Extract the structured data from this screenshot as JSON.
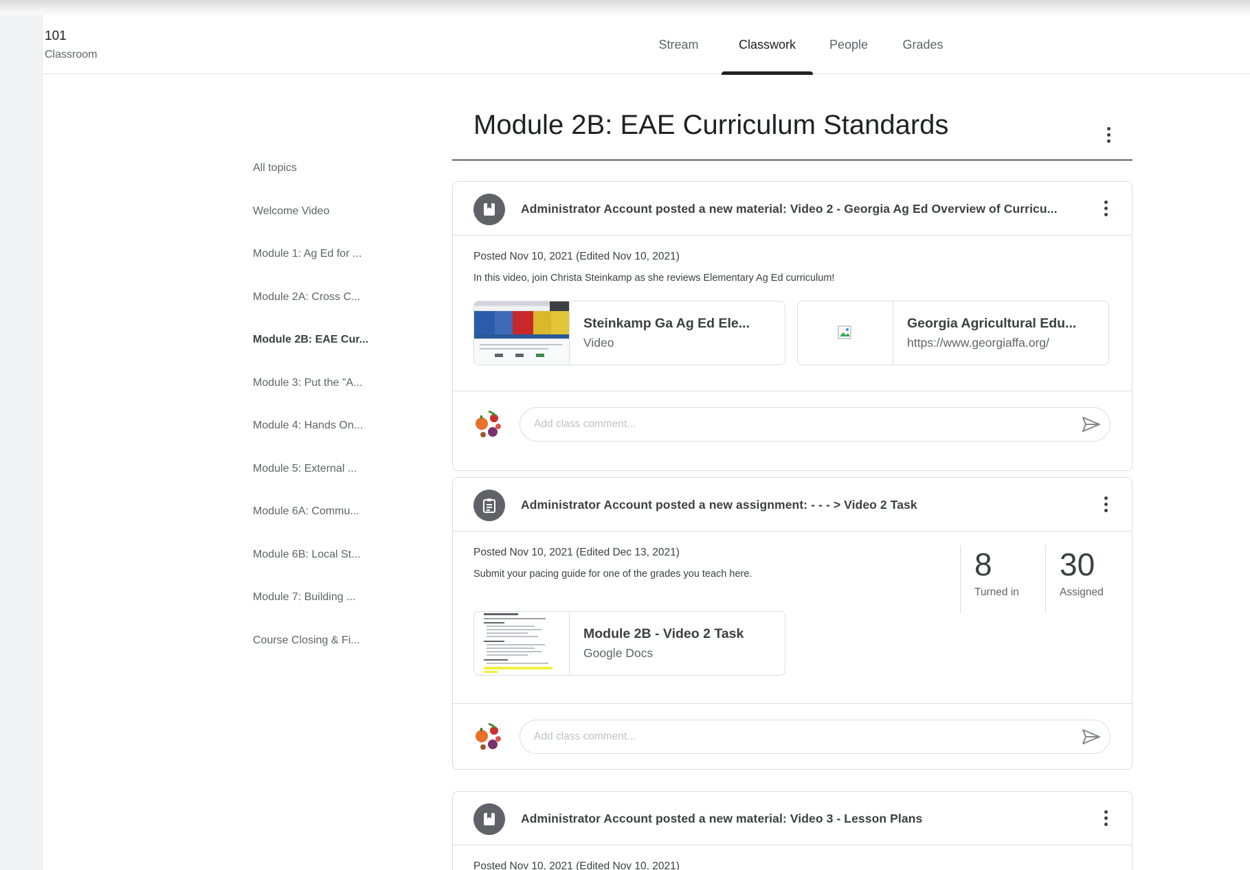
{
  "header": {
    "class_name": "101",
    "class_subtitle": "Classroom",
    "tabs": [
      {
        "label": "Stream",
        "active": false
      },
      {
        "label": "Classwork",
        "active": true
      },
      {
        "label": "People",
        "active": false
      },
      {
        "label": "Grades",
        "active": false
      }
    ]
  },
  "topics": [
    {
      "label": "All topics",
      "active": false
    },
    {
      "label": "Welcome Video",
      "active": false
    },
    {
      "label": "Module 1: Ag Ed for ...",
      "active": false
    },
    {
      "label": "Module 2A: Cross C...",
      "active": false
    },
    {
      "label": "Module 2B: EAE Cur...",
      "active": true
    },
    {
      "label": "Module 3: Put the \"A...",
      "active": false
    },
    {
      "label": "Module 4: Hands On...",
      "active": false
    },
    {
      "label": "Module 5: External ...",
      "active": false
    },
    {
      "label": "Module 6A: Commu...",
      "active": false
    },
    {
      "label": "Module 6B: Local St...",
      "active": false
    },
    {
      "label": "Module 7: Building ...",
      "active": false
    },
    {
      "label": "Course Closing & Fi...",
      "active": false
    }
  ],
  "section": {
    "title": "Module 2B: EAE Curriculum Standards"
  },
  "posts": [
    {
      "icon": "material-icon",
      "title": "Administrator Account posted a new material: Video 2 - Georgia Ag Ed Overview of Curricu...",
      "posted": "Posted Nov 10, 2021 (Edited Nov 10, 2021)",
      "description": "In this video, join Christa Steinkamp as she reviews Elementary Ag Ed curriculum!",
      "attachments": [
        {
          "title": "Steinkamp Ga Ag Ed Ele...",
          "subtitle": "Video",
          "thumb": "video-thumbnail"
        },
        {
          "title": "Georgia Agricultural Edu...",
          "subtitle": "https://www.georgiaffa.org/",
          "thumb": "broken-image-icon"
        }
      ],
      "comment_placeholder": "Add class comment..."
    },
    {
      "icon": "assignment-icon",
      "title": "Administrator Account posted a new assignment: - - - > Video 2 Task",
      "posted": "Posted Nov 10, 2021 (Edited Dec 13, 2021)",
      "description": "Submit your pacing guide for one of the grades you teach here.",
      "stats": [
        {
          "value": "8",
          "label": "Turned in"
        },
        {
          "value": "30",
          "label": "Assigned"
        }
      ],
      "attachments": [
        {
          "title": "Module 2B - Video 2 Task",
          "subtitle": "Google Docs",
          "thumb": "doc-thumbnail"
        }
      ],
      "comment_placeholder": "Add class comment..."
    },
    {
      "icon": "material-icon",
      "title": "Administrator Account posted a new material: Video 3 - Lesson Plans",
      "posted": "Posted Nov 10, 2021 (Edited Nov 10, 2021)"
    }
  ],
  "colors": {
    "text_primary": "#202124",
    "text_secondary": "#5f6368",
    "border": "#dadce0",
    "icon_circle": "#5f6368"
  }
}
